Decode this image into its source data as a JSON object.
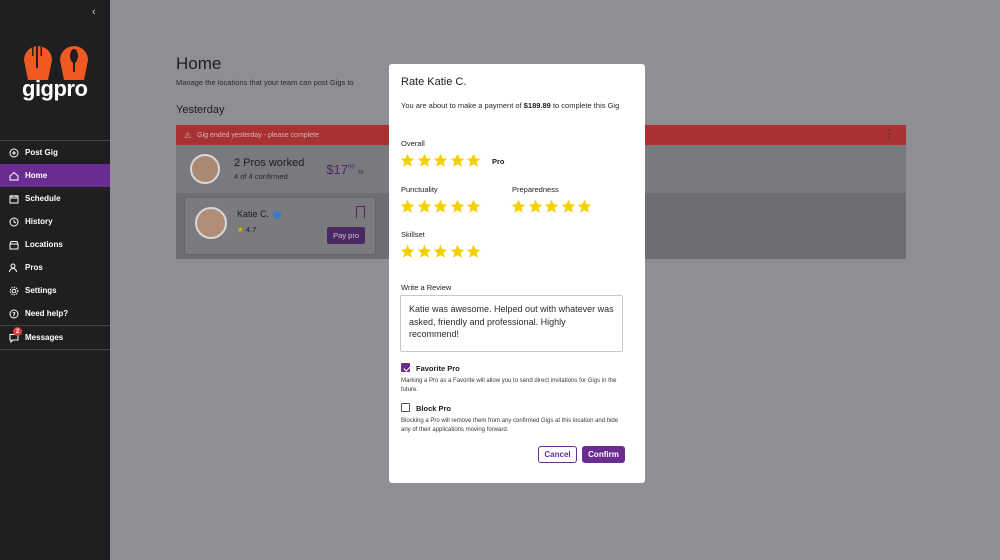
{
  "brand": {
    "name": "gigpro",
    "accent": "#6b2c91",
    "logo_color": "#f05a22"
  },
  "sidebar": {
    "collapse_icon": "chevron-left-icon",
    "items": [
      {
        "label": "Post Gig",
        "icon": "plus-circle-icon",
        "active": false
      },
      {
        "label": "Home",
        "icon": "home-icon",
        "active": true
      },
      {
        "label": "Schedule",
        "icon": "calendar-icon",
        "active": false
      },
      {
        "label": "History",
        "icon": "history-icon",
        "active": false
      },
      {
        "label": "Locations",
        "icon": "store-icon",
        "active": false
      },
      {
        "label": "Pros",
        "icon": "users-icon",
        "active": false
      },
      {
        "label": "Settings",
        "icon": "gear-icon",
        "active": false
      },
      {
        "label": "Need help?",
        "icon": "help-icon",
        "active": false
      },
      {
        "label": "Messages",
        "icon": "chat-icon",
        "active": false,
        "badge": "2"
      }
    ]
  },
  "main": {
    "title": "Home",
    "subtitle": "Manage the locations that your team can post Gigs to",
    "section": "Yesterday",
    "gig": {
      "alert": "Gig ended yesterday - please complete",
      "pros_worked": "2 Pros worked",
      "confirmed": "4 of 4 confirmed",
      "rate_dollars": "$17",
      "rate_cents": "00",
      "rate_unit": "hr",
      "pro": {
        "name": "Katie C.",
        "rating": "4.7",
        "pay_label": "Pay pro"
      }
    }
  },
  "modal": {
    "title": "Rate Katie C.",
    "desc_prefix": "You are about to make a payment of",
    "amount": "$189.89",
    "desc_suffix": "to complete this Gig",
    "overall_label": "Overall",
    "overall_stars": 5,
    "overall_tag": "Pro",
    "punctuality_label": "Punctuality",
    "punctuality_stars": 5,
    "preparedness_label": "Preparedness",
    "preparedness_stars": 5,
    "skillset_label": "Skillset",
    "skillset_stars": 5,
    "review_label": "Write a Review",
    "review_text": "Katie was awesome. Helped out with whatever was asked, friendly and professional. Highly recommend!",
    "favorite_label": "Favorite Pro",
    "favorite_checked": true,
    "favorite_note": "Marking a Pro as a Favorite will allow you to send direct invitations for Gigs in the future.",
    "block_label": "Block Pro",
    "block_checked": false,
    "block_note": "Blocking a Pro will remove them from any confirmed Gigs at this location and hide any of their applications moving forward.",
    "cancel_label": "Cancel",
    "confirm_label": "Confirm",
    "star_color": "#f5d000"
  }
}
